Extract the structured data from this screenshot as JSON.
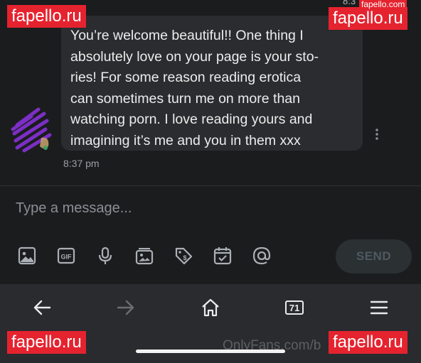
{
  "status": {
    "time_partial": "8:3"
  },
  "message": {
    "lines": [
      "You’re welcome beautiful!! One thing I",
      "absolutely love on your page is your sto-",
      "ries! For some reason reading erotica",
      "can sometimes turn me on more than",
      "watching porn. I love reading yours and",
      "imagining it’s me and you in them xxx"
    ],
    "time": "8:37 pm"
  },
  "composer": {
    "placeholder": "Type a message...",
    "tools": [
      "image-icon",
      "gif-icon",
      "microphone-icon",
      "media-vault-icon",
      "price-tag-icon",
      "calendar-icon",
      "mention-icon"
    ],
    "gif_label": "GIF",
    "send_label": "SEND"
  },
  "browser": {
    "tab_count": "71",
    "url": "OnlyFans.com/b"
  },
  "watermarks": {
    "text": "fapello.ru",
    "small": "fapello.com"
  },
  "colors": {
    "background": "#1b1c1e",
    "bubble": "#2a2c2f",
    "navbar": "#2a2b2f",
    "watermark": "#e5232f"
  }
}
